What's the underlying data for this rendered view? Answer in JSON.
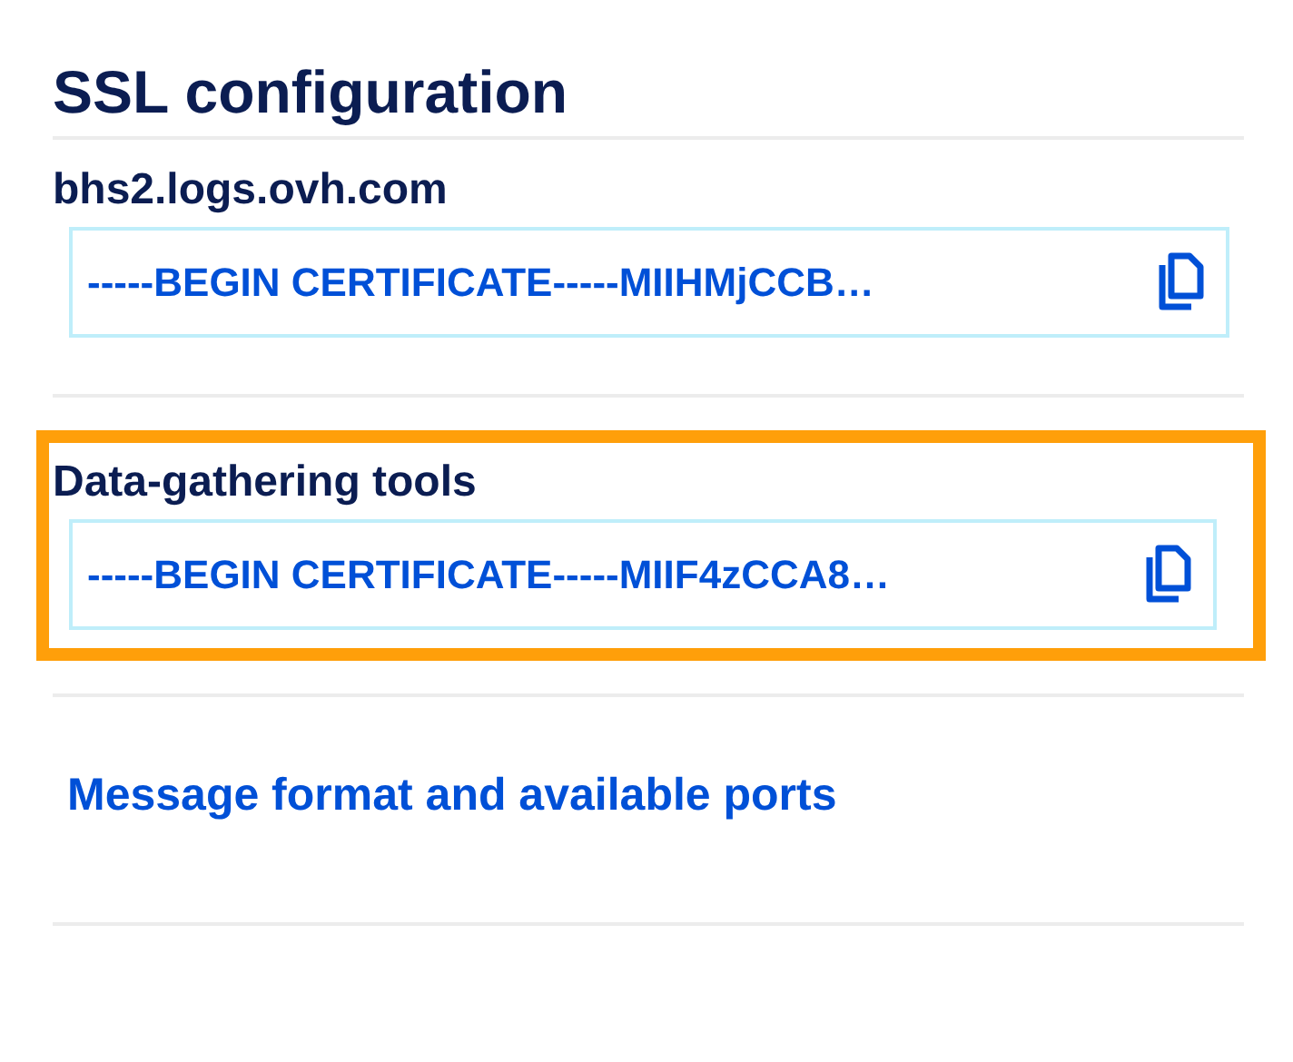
{
  "title": "SSL configuration",
  "certificates": [
    {
      "label": "bhs2.logs.ovh.com",
      "value": "-----BEGIN CERTIFICATE-----MIIHMjCCB…",
      "highlighted": false
    },
    {
      "label": "Data-gathering tools",
      "value": "-----BEGIN CERTIFICATE-----MIIF4zCCA8…",
      "highlighted": true
    }
  ],
  "link": "Message format and available ports"
}
